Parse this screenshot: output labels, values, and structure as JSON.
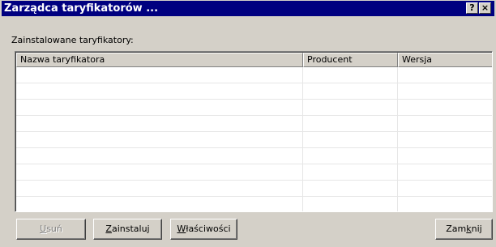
{
  "window": {
    "title": "Zarządca taryfikatorów ...",
    "help_button": "?",
    "close_button": "×"
  },
  "installed": {
    "label": "Zainstalowane taryfikatory:",
    "columns": [
      "Nazwa taryfikatora",
      "Producent",
      "Wersja"
    ],
    "rows": []
  },
  "buttons": {
    "remove": {
      "mnemonic": "U",
      "rest": "suń",
      "enabled": false
    },
    "install": {
      "mnemonic": "Z",
      "rest": "ainstaluj",
      "enabled": true
    },
    "properties": {
      "mnemonic": "W",
      "rest": "łaściwości",
      "enabled": true
    },
    "close": {
      "prefix": "Zam",
      "mnemonic": "k",
      "rest": "nij",
      "enabled": true
    }
  }
}
